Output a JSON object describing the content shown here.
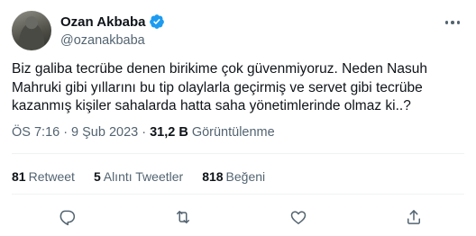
{
  "author": {
    "display_name": "Ozan Akbaba",
    "handle": "@ozanakbaba",
    "verified": true,
    "verified_color": "#1d9bf0"
  },
  "tweet": {
    "text": "Biz galiba tecrübe denen birikime çok güvenmiyoruz. Neden Nasuh Mahruki gibi yıllarını bu tip olaylarla geçirmiş ve servet gibi tecrübe kazanmış kişiler sahalarda hatta saha yönetimlerinde olmaz ki..?",
    "time": "ÖS 7:16",
    "date": "9 Şub 2023",
    "views_count": "31,2 B",
    "views_label": "Görüntülenme"
  },
  "stats": {
    "retweets_count": "81",
    "retweets_label": "Retweet",
    "quotes_count": "5",
    "quotes_label": "Alıntı Tweetler",
    "likes_count": "818",
    "likes_label": "Beğeni"
  },
  "icons": {
    "avatar": "profile-photo",
    "verified": "verified-badge-icon",
    "more": "more-options-icon",
    "reply": "reply-icon",
    "retweet": "retweet-icon",
    "like": "like-icon",
    "share": "share-icon"
  },
  "colors": {
    "text_primary": "#0f1419",
    "text_secondary": "#536471",
    "divider": "#eff3f4"
  }
}
